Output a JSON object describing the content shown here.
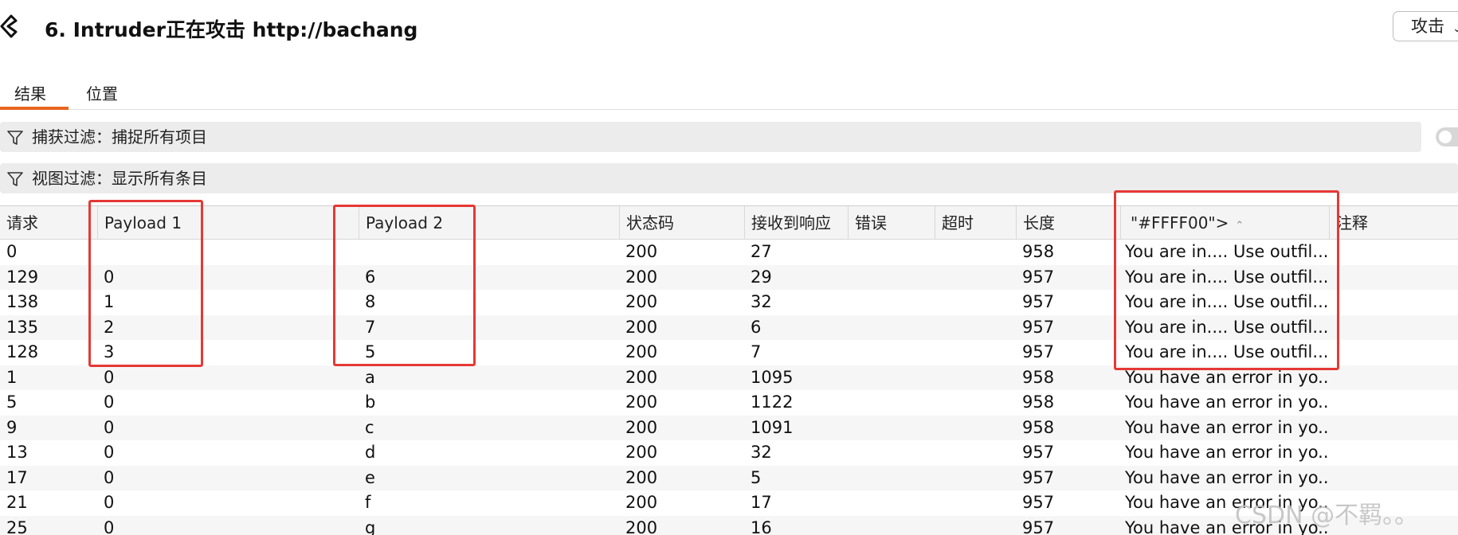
{
  "window": {
    "title": "6. Intruder正在攻击 http://bachang",
    "attack_button": "攻击"
  },
  "tabs": [
    {
      "label": "结果",
      "active": true
    },
    {
      "label": "位置",
      "active": false
    }
  ],
  "filters": {
    "capture": "捕获过滤：捕捉所有项目",
    "view": "视图过滤：显示所有条目"
  },
  "table": {
    "columns": [
      "请求",
      "Payload 1",
      "Payload 2",
      "状态码",
      "接收到响应",
      "错误",
      "超时",
      "长度",
      "\"#FFFF00\">",
      "注释"
    ],
    "sorted_column": "\"#FFFF00\">",
    "rows": [
      [
        "0",
        "",
        "",
        "200",
        "27",
        "",
        "",
        "958",
        "You are in.... Use outfil...",
        ""
      ],
      [
        "129",
        "0",
        "6",
        "200",
        "29",
        "",
        "",
        "957",
        "You are in.... Use outfil...",
        ""
      ],
      [
        "138",
        "1",
        "8",
        "200",
        "32",
        "",
        "",
        "957",
        "You are in.... Use outfil...",
        ""
      ],
      [
        "135",
        "2",
        "7",
        "200",
        "6",
        "",
        "",
        "957",
        "You are in.... Use outfil...",
        ""
      ],
      [
        "128",
        "3",
        "5",
        "200",
        "7",
        "",
        "",
        "957",
        "You are in.... Use outfil...",
        ""
      ],
      [
        "1",
        "0",
        "a",
        "200",
        "1095",
        "",
        "",
        "958",
        "You have an error in yo...",
        ""
      ],
      [
        "5",
        "0",
        "b",
        "200",
        "1122",
        "",
        "",
        "958",
        "You have an error in yo...",
        ""
      ],
      [
        "9",
        "0",
        "c",
        "200",
        "1091",
        "",
        "",
        "958",
        "You have an error in yo...",
        ""
      ],
      [
        "13",
        "0",
        "d",
        "200",
        "32",
        "",
        "",
        "957",
        "You have an error in yo...",
        ""
      ],
      [
        "17",
        "0",
        "e",
        "200",
        "5",
        "",
        "",
        "957",
        "You have an error in yo...",
        ""
      ],
      [
        "21",
        "0",
        "f",
        "200",
        "17",
        "",
        "",
        "957",
        "You have an error in yo...",
        ""
      ],
      [
        "25",
        "0",
        "g",
        "200",
        "16",
        "",
        "",
        "957",
        "You have an error in yo...",
        ""
      ]
    ]
  },
  "colors": {
    "accent": "#e8651f",
    "highlight": "#e53935"
  },
  "watermark": "CSDN @不羁。。"
}
